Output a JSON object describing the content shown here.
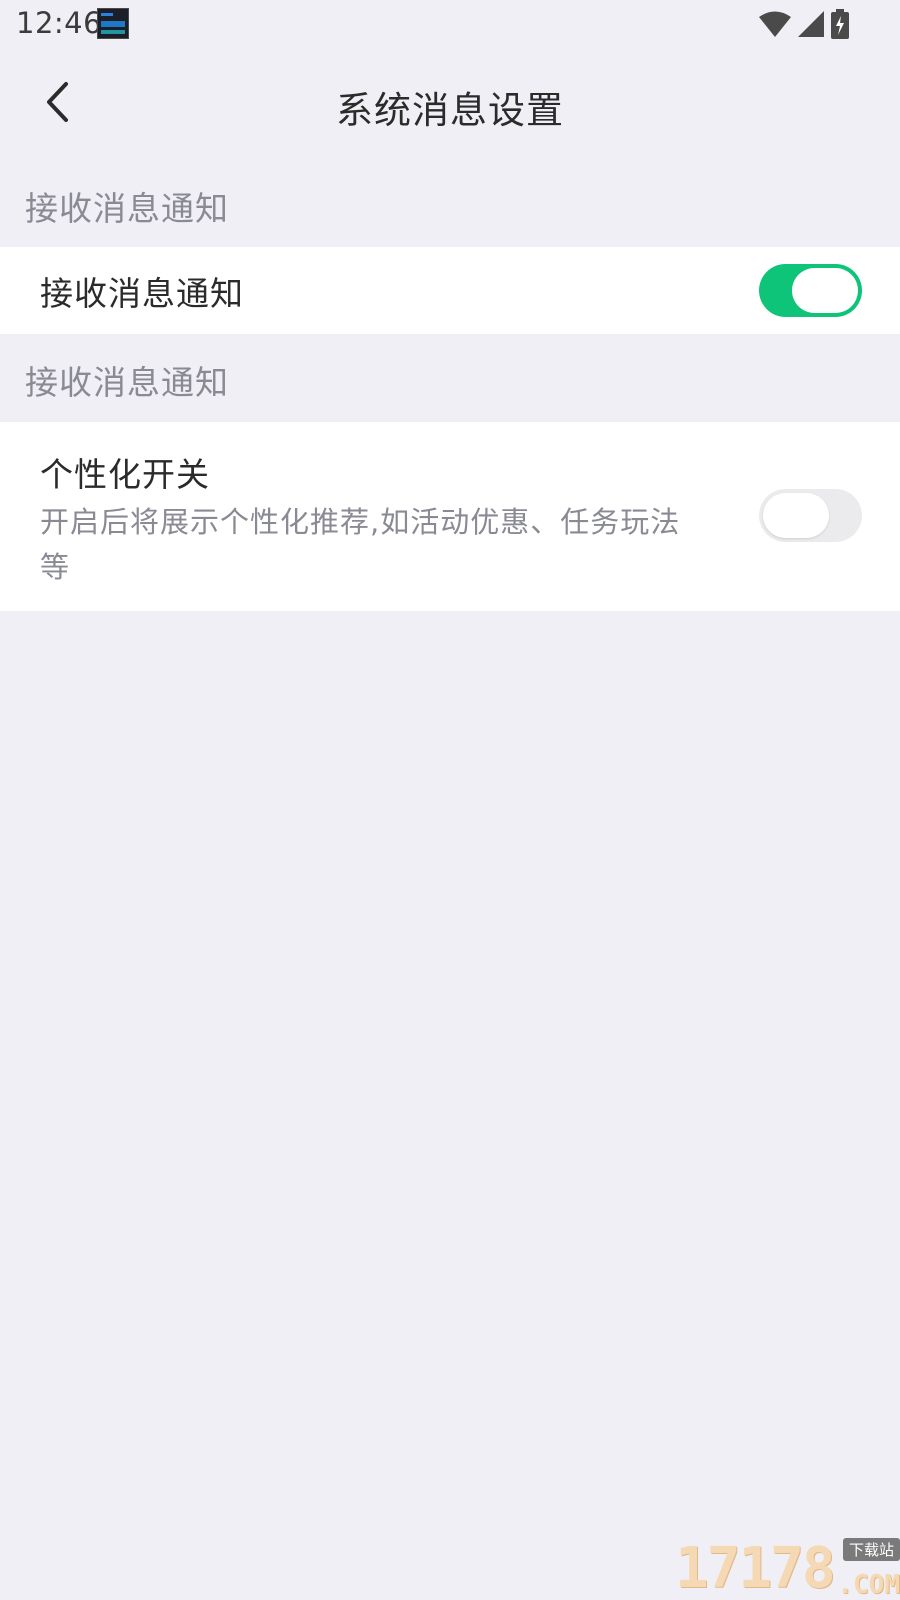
{
  "status_bar": {
    "time": "12:46",
    "icons": [
      "notification-thumbnail",
      "wifi-icon",
      "cellular-signal-icon",
      "battery-charging-icon"
    ]
  },
  "header": {
    "back_icon": "chevron-left-icon",
    "title": "系统消息设置"
  },
  "sections": [
    {
      "header": "接收消息通知",
      "rows": [
        {
          "label": "接收消息通知",
          "toggle_on": true
        }
      ]
    },
    {
      "header": "接收消息通知",
      "rows": [
        {
          "label": "个性化开关",
          "description": "开启后将展示个性化推荐,如活动优惠、任务玩法等",
          "toggle_on": false
        }
      ]
    }
  ],
  "colors": {
    "background": "#f0eff5",
    "card": "#ffffff",
    "toggle_on": "#0dc478",
    "toggle_off": "#ebebee",
    "secondary_text": "#8a8a95",
    "primary_text": "#2b2b2b"
  },
  "watermark": {
    "digits": "17178",
    "badge": "下载站",
    "suffix": ".COM"
  }
}
